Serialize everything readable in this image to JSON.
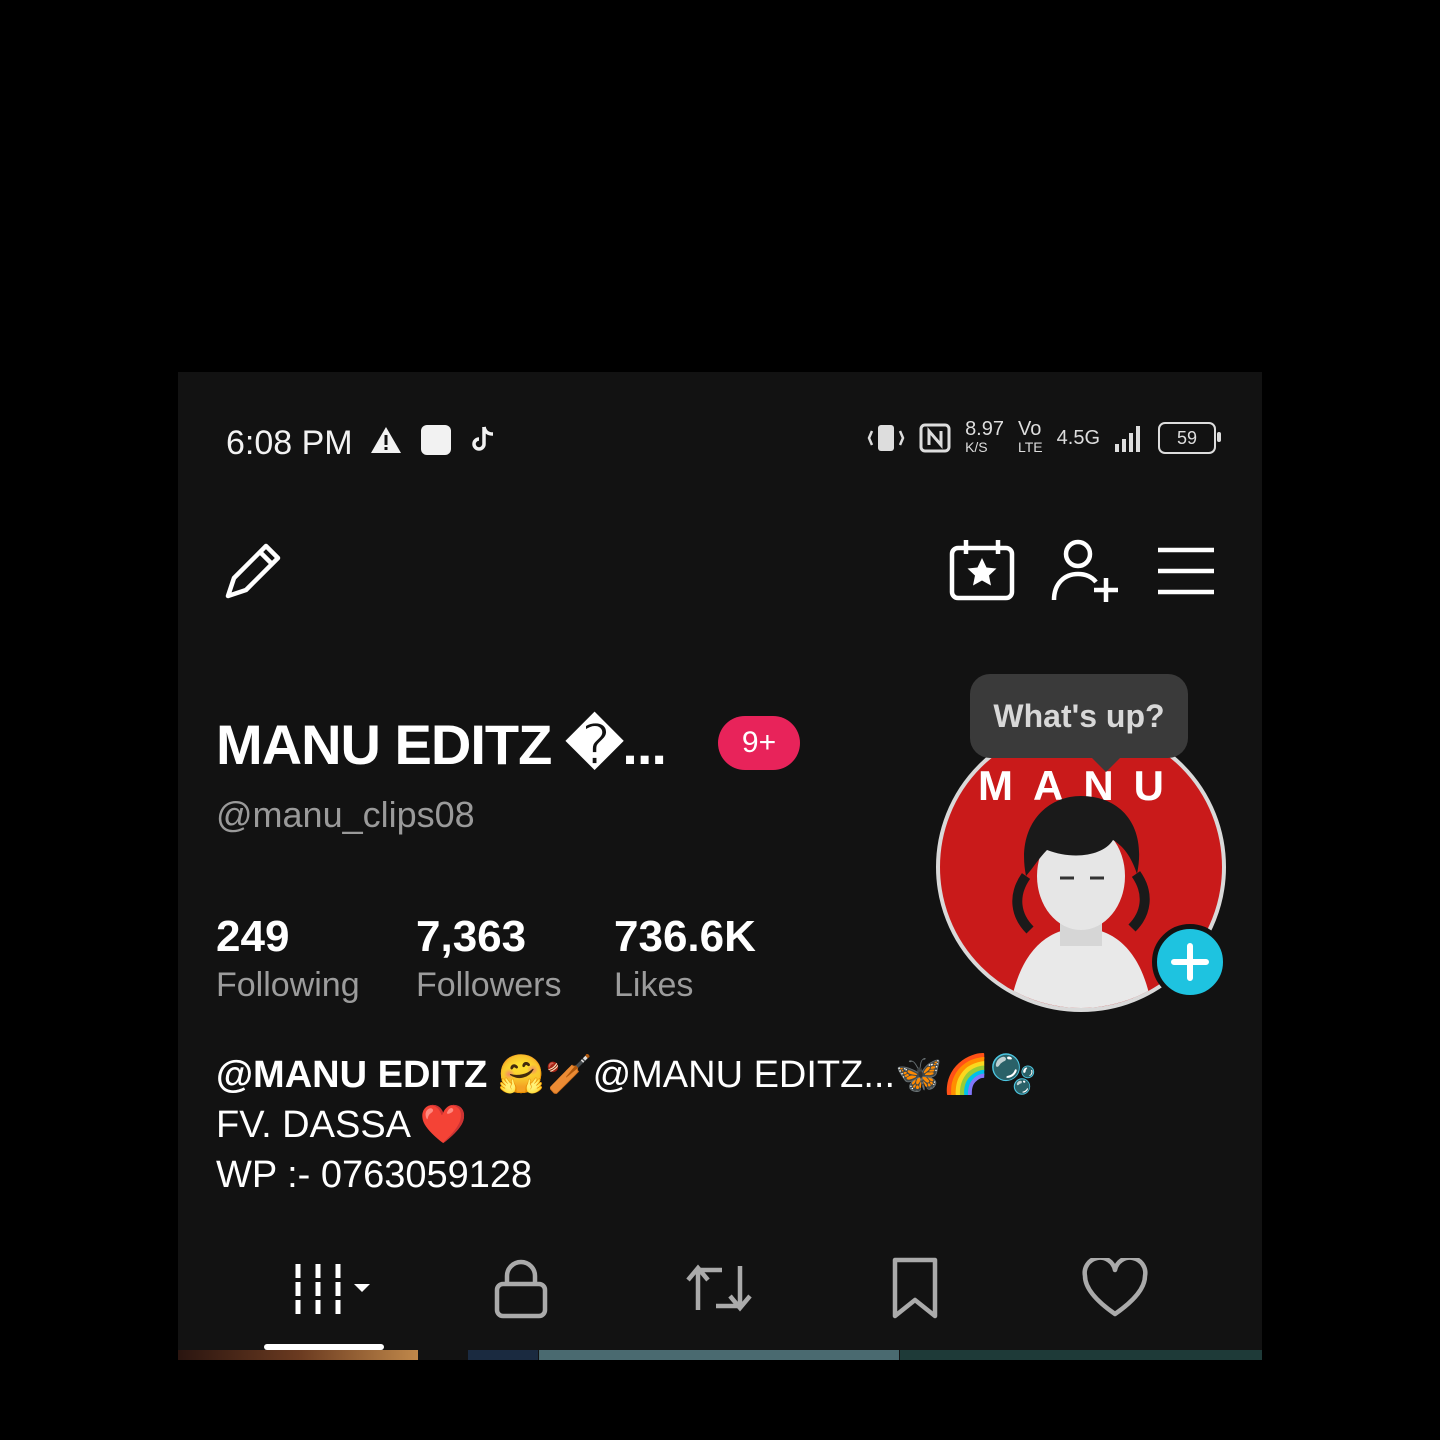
{
  "status_bar": {
    "time": "6:08 PM",
    "speed_value": "8.97",
    "speed_unit": "K/S",
    "volte_top": "Vo",
    "volte_bottom": "LTE",
    "network": "4.5G",
    "battery": "59"
  },
  "profile": {
    "name": "MANU EDITZ �...",
    "notification_badge": "9+",
    "handle": "@manu_clips08",
    "whats_up": "What's up?",
    "avatar_text": "MANU",
    "stats": [
      {
        "value": "249",
        "label": "Following"
      },
      {
        "value": "7,363",
        "label": "Followers"
      },
      {
        "value": "736.6K",
        "label": "Likes"
      }
    ],
    "bio": {
      "line1_bold": "@MANU EDITZ 🤗🏏",
      "line1_rest": "@MANU EDITZ...🦋🌈🫧",
      "line2": "FV. DASSA ❤️",
      "line3": "WP :- 0763059128"
    }
  },
  "colors": {
    "background": "#121212",
    "badge": "#e8235a",
    "avatar_bg": "#c91a1a",
    "add_button": "#1ec3e0"
  },
  "icons": {
    "edit": "pencil-icon",
    "events": "calendar-star-icon",
    "add_friend": "add-user-icon",
    "menu": "hamburger-menu-icon",
    "tabs": [
      "grid-icon",
      "lock-icon",
      "repost-icon",
      "bookmark-icon",
      "heart-icon"
    ]
  }
}
